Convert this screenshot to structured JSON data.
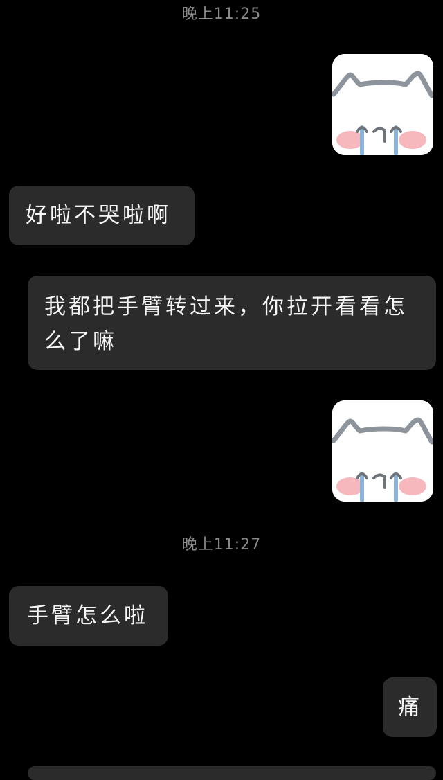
{
  "chat": {
    "timestamp_1": "晚上11:25",
    "timestamp_2": "晚上11:27",
    "messages": [
      {
        "side": "received",
        "text": "好啦不哭啦啊"
      },
      {
        "side": "received",
        "text": "我都把手臂转过来，你拉开看看怎么了嘛"
      },
      {
        "side": "received",
        "text": "手臂怎么啦"
      },
      {
        "side": "sent",
        "text": "痛"
      }
    ],
    "stickers": [
      {
        "side": "sent",
        "icon": "crying-cat-sticker-icon"
      },
      {
        "side": "sent",
        "icon": "crying-cat-sticker-icon"
      }
    ]
  },
  "colors": {
    "background": "#000000",
    "bubble": "#2b2b2b",
    "timestamp": "#8a8a8a",
    "text": "#f5f5f5"
  }
}
